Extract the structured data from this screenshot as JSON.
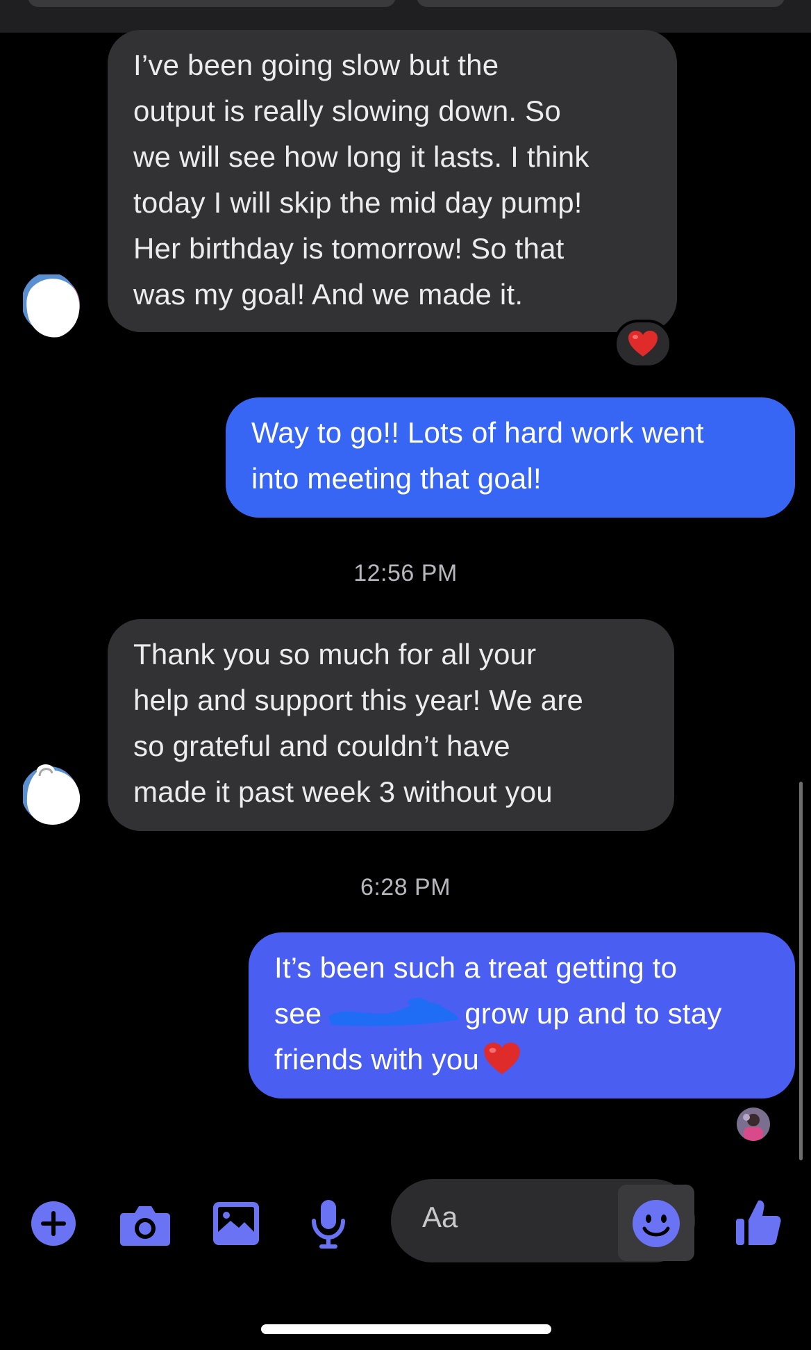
{
  "conversation": {
    "messages": [
      {
        "direction": "incoming",
        "text": "I’ve been going slow but the\noutput is really slowing down. So\nwe will see how long it lasts. I think\ntoday I will skip the mid day pump!\nHer birthday is tomorrow! So that\nwas my goal! And we made it.",
        "reaction": "heart-emoji"
      },
      {
        "direction": "outgoing",
        "text": "Way to go!! Lots of hard work went\ninto meeting that goal!"
      },
      {
        "direction": "incoming",
        "text": "Thank you so much for all your\nhelp and support this year! We are\nso grateful and couldn’t have\nmade it past week 3 without you"
      },
      {
        "direction": "outgoing",
        "text_line1": "It’s been such a treat getting to",
        "text_line2_start": "see",
        "text_line2_end": "grow up and to stay",
        "text_line3": "friends with you",
        "emoji": "heart-emoji"
      }
    ],
    "timestamps": [
      "12:56 PM",
      "6:28 PM"
    ]
  },
  "composer": {
    "placeholder": "Aa",
    "icons": [
      "plus-icon",
      "camera-icon",
      "image-icon",
      "microphone-icon",
      "emoji-icon",
      "thumbs-up-icon"
    ]
  },
  "colors": {
    "background": "#000000",
    "incoming_bubble": "#323234",
    "outgoing_bubble_1": "#3766f4",
    "outgoing_bubble_2": "#4a5ef2",
    "accent_icon": "#6b73f5",
    "redaction": "#1f6cf5"
  }
}
